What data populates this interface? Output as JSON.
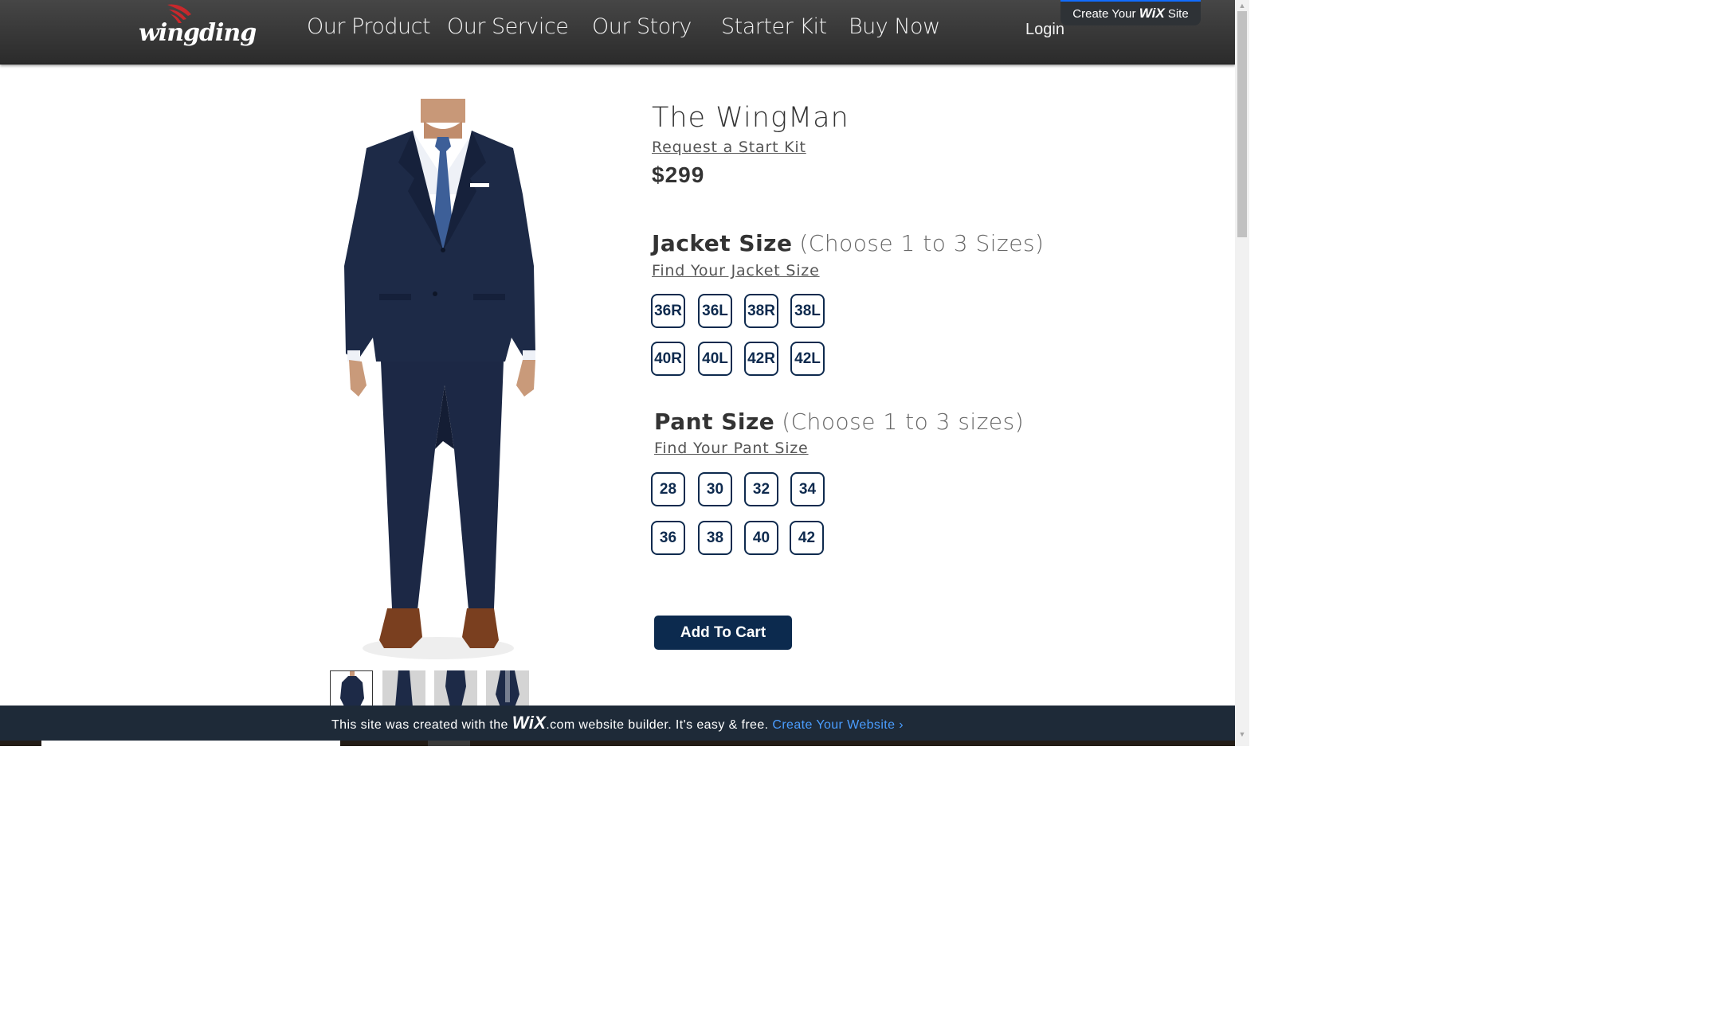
{
  "header": {
    "logo_text": "wingding",
    "nav": [
      "Our Product",
      "Our Service",
      "Our Story",
      "Starter Kit",
      "Buy Now"
    ],
    "login": "Login",
    "wix_create": {
      "prefix": "Create Your",
      "brand": "WiX",
      "suffix": "Site"
    }
  },
  "product": {
    "title": "The WingMan",
    "request_link": "Request a Start Kit",
    "price": "$299",
    "jacket": {
      "title": "Jacket Size",
      "note": "(Choose 1 to 3 Sizes)",
      "find_link": "Find Your Jacket Size",
      "sizes": [
        "36R",
        "36L",
        "38R",
        "38L",
        "40R",
        "40L",
        "42R",
        "42L"
      ]
    },
    "pant": {
      "title": "Pant Size",
      "note": "(Choose 1 to 3 sizes)",
      "find_link": "Find Your Pant Size",
      "sizes": [
        "28",
        "30",
        "32",
        "34",
        "36",
        "38",
        "40",
        "42"
      ]
    },
    "add_to_cart": "Add To Cart",
    "accent_color": "#0c2a4e"
  },
  "wix_banner": {
    "before": "This site was created with the",
    "brand": "WiX",
    "after": ".com website builder. It's easy & free.",
    "cta": "Create Your Website ›"
  }
}
